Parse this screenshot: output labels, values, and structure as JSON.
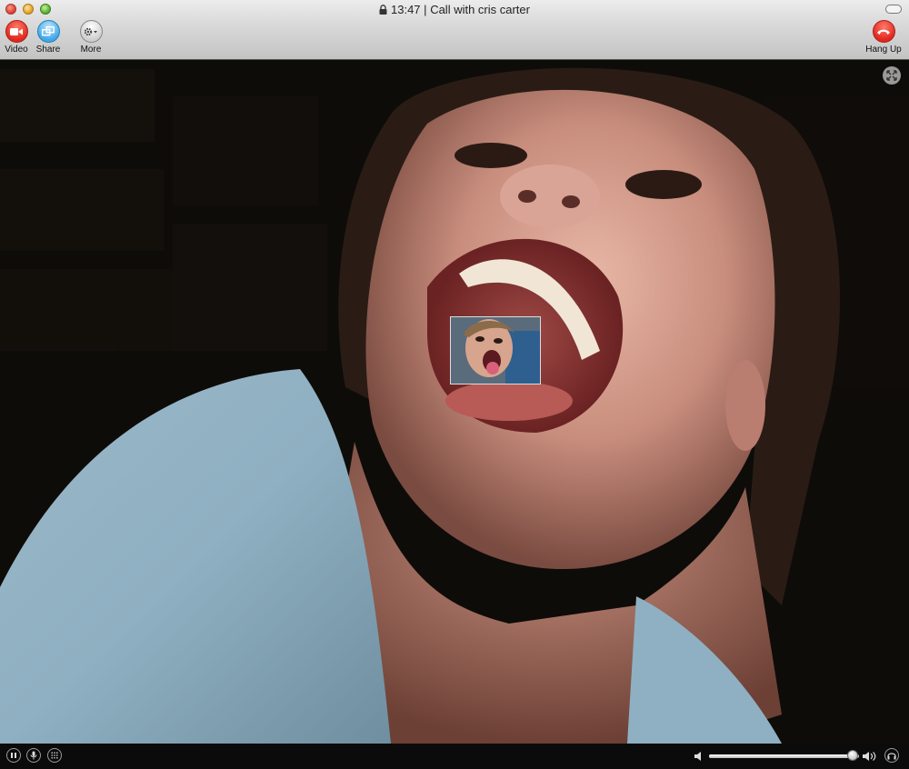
{
  "window": {
    "time": "13:47",
    "separator": "|",
    "title": "Call with cris carter"
  },
  "toolbar": {
    "video_label": "Video",
    "share_label": "Share",
    "more_label": "More",
    "hangup_label": "Hang Up"
  },
  "icons": {
    "video": "video-camera-icon",
    "share": "share-screen-icon",
    "more": "gear-icon",
    "hangup": "phone-hangup-icon",
    "fullscreen": "expand-icon",
    "pause": "pause-icon",
    "mic": "microphone-icon",
    "dialpad": "dialpad-icon",
    "volume_low": "speaker-low-icon",
    "volume_high": "speaker-high-icon",
    "audio": "headphones-icon"
  },
  "colors": {
    "video_button": "#e2271d",
    "share_button": "#3fa7e8",
    "hangup_button": "#e2271d"
  },
  "volume": {
    "level": 0.96
  }
}
